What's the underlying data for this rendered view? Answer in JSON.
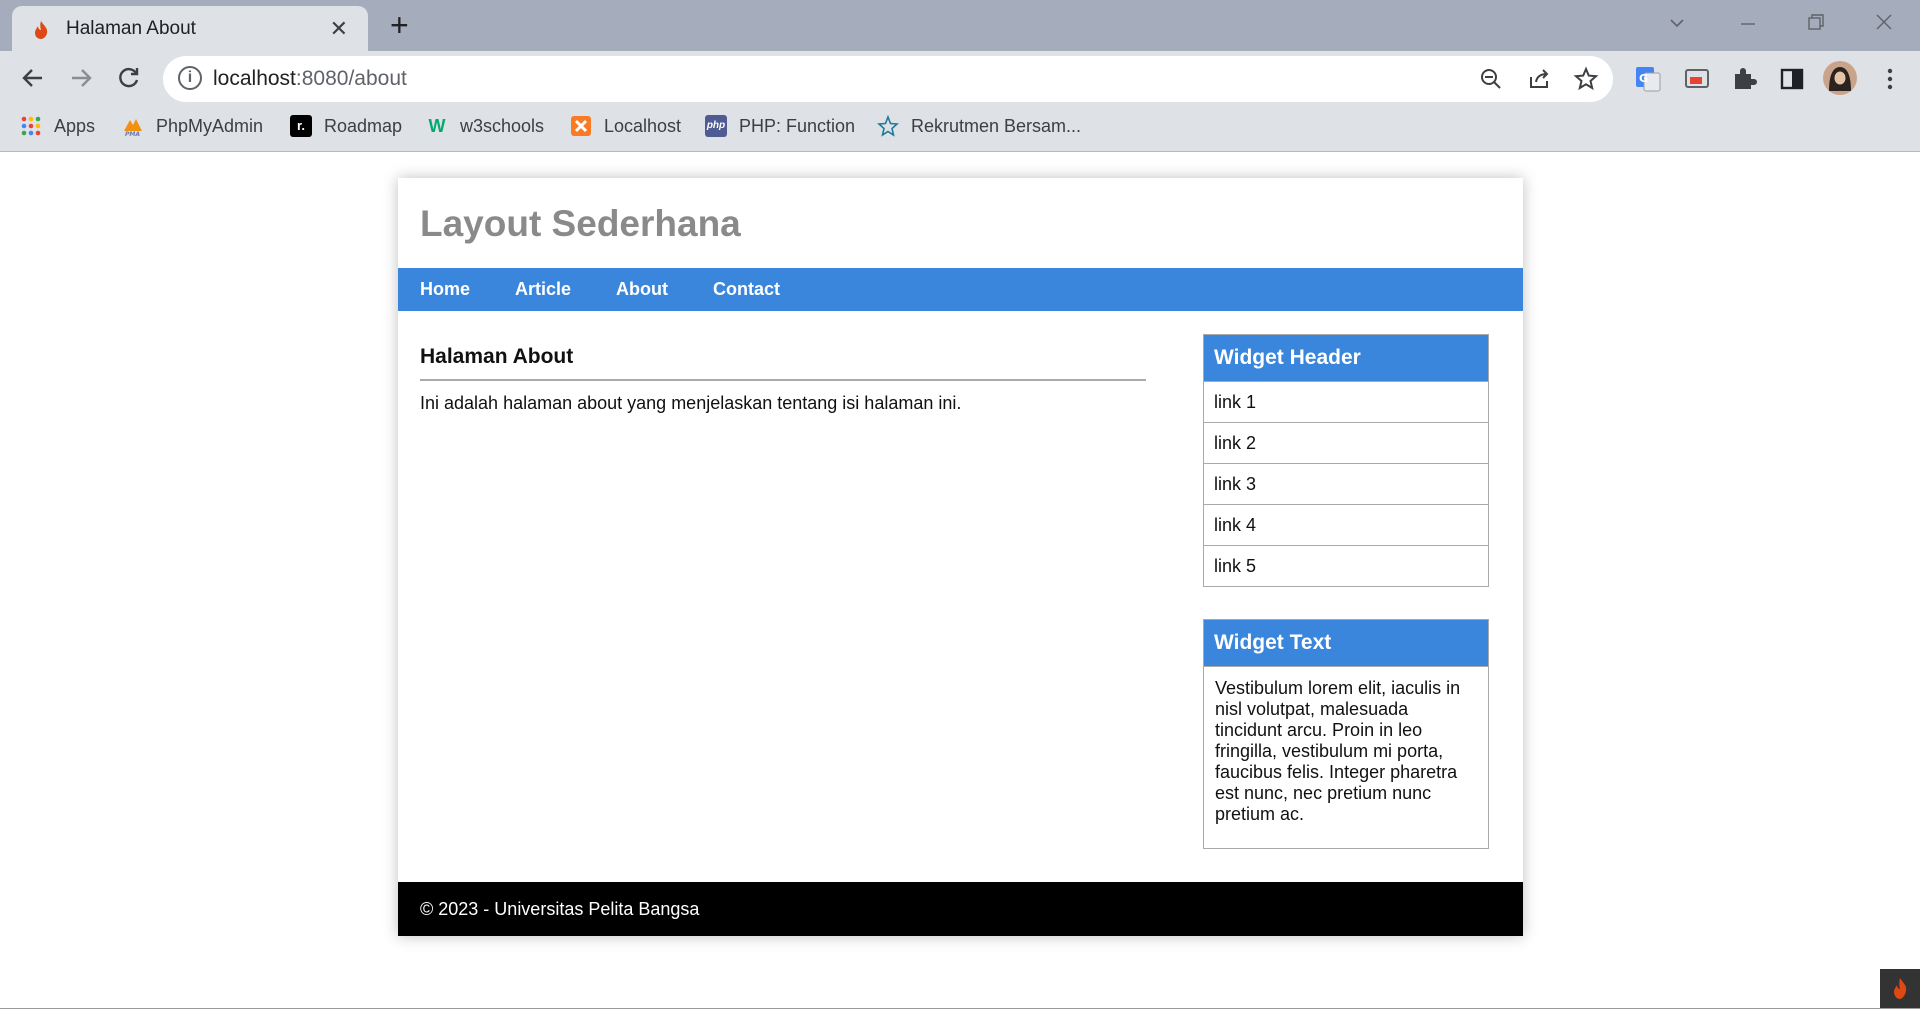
{
  "browser": {
    "tab_title": "Halaman About",
    "close_glyph": "✕",
    "new_tab_glyph": "+",
    "url_host": "localhost",
    "url_rest": ":8080/about",
    "bookmarks": [
      {
        "label": "Apps",
        "icon": "apps-grid-icon",
        "color": "#ea4335"
      },
      {
        "label": "PhpMyAdmin",
        "icon": "phpmyadmin-icon",
        "color": "#f29111"
      },
      {
        "label": "Roadmap",
        "icon": "roadmap-icon",
        "color": "#000000"
      },
      {
        "label": "w3schools",
        "icon": "w3schools-icon",
        "color": "#04aa6d"
      },
      {
        "label": "Localhost",
        "icon": "xampp-icon",
        "color": "#fb7a24"
      },
      {
        "label": "PHP: Function",
        "icon": "php-icon",
        "color": "#4f5b93"
      },
      {
        "label": "Rekrutmen Bersam...",
        "icon": "rekrutmen-icon",
        "color": "#1f7a9a"
      }
    ]
  },
  "site": {
    "title": "Layout Sederhana",
    "nav": [
      "Home",
      "Article",
      "About",
      "Contact"
    ],
    "main_heading": "Halaman About",
    "main_text": "Ini adalah halaman about yang menjelaskan tentang isi halaman ini.",
    "widget_header": {
      "title": "Widget Header",
      "links": [
        "link 1",
        "link 2",
        "link 3",
        "link 4",
        "link 5"
      ]
    },
    "widget_text": {
      "title": "Widget Text",
      "body": "Vestibulum lorem elit, iaculis in nisl volutpat, malesuada tincidunt arcu. Proin in leo fringilla, vestibulum mi porta, faucibus felis. Integer pharetra est nunc, nec pretium nunc pretium ac."
    },
    "footer": "© 2023 - Universitas Pelita Bangsa",
    "accent_color": "#3a86dd"
  }
}
